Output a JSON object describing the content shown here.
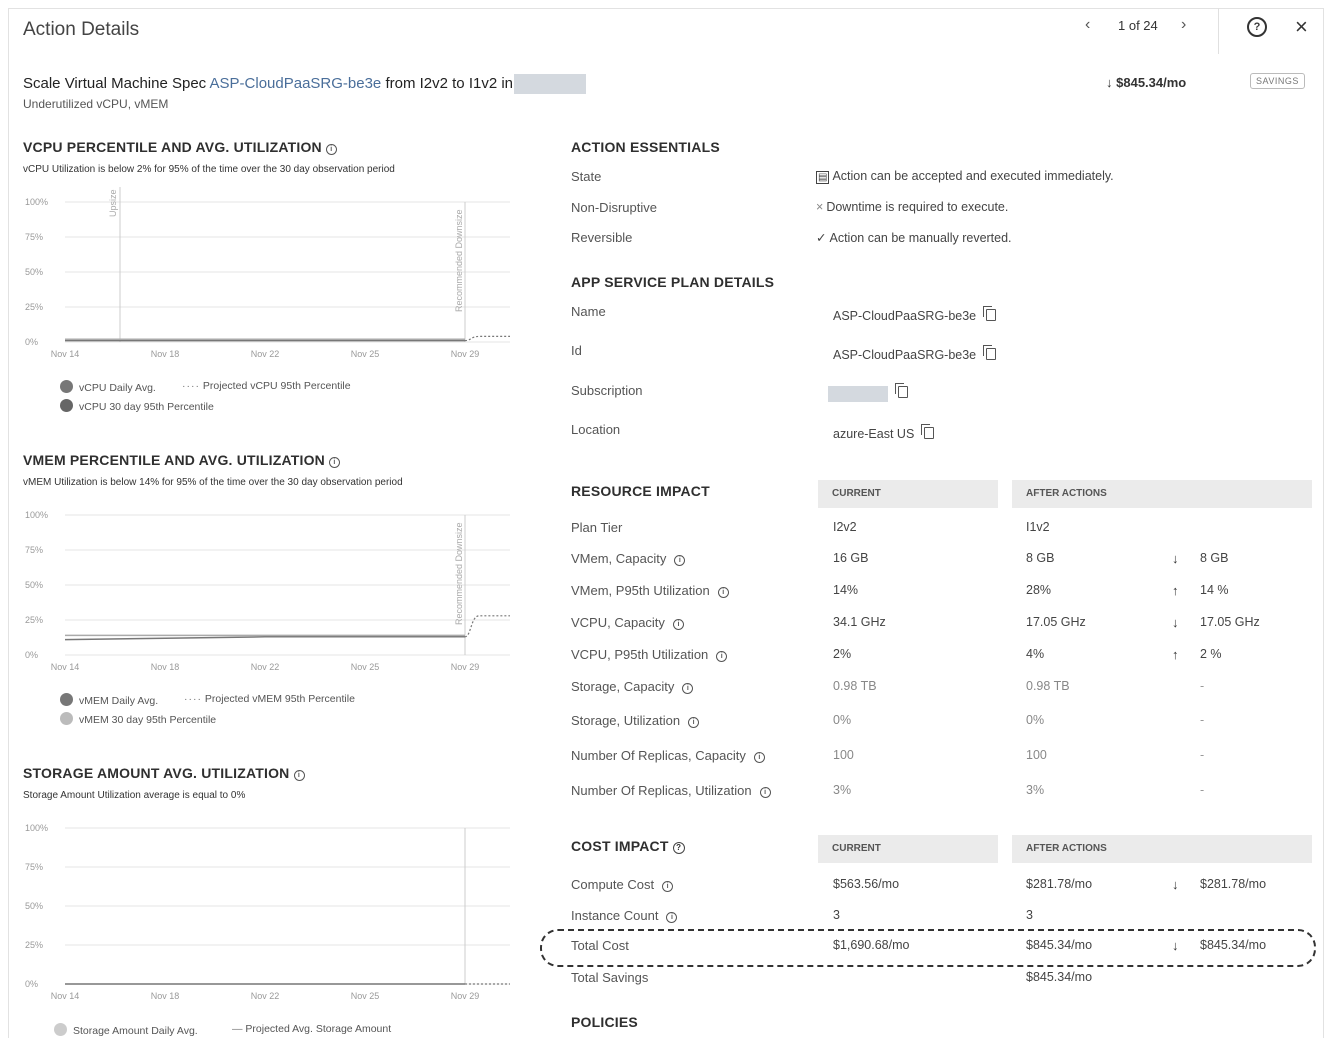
{
  "header": {
    "title": "Action Details",
    "prev_icon": "chevron-left-icon",
    "page_indicator": "1 of 24",
    "next_icon": "chevron-right-icon",
    "help_icon": "help-circle-icon",
    "close_icon": "close-icon"
  },
  "action": {
    "prefix": "Scale Virtual Machine Spec",
    "entity": "ASP-CloudPaaSRG-be3e",
    "suffix": "from I2v2 to I1v2 in",
    "subtitle": "Underutilized vCPU, vMEM",
    "savings_amount": "$845.34/mo",
    "badge": "SAVINGS"
  },
  "charts": {
    "x_ticks": [
      "Nov 14",
      "Nov 18",
      "Nov 22",
      "Nov 25",
      "Nov 29"
    ],
    "y_ticks": [
      "100%",
      "75%",
      "50%",
      "25%",
      "0%"
    ],
    "vcpu": {
      "title": "VCPU PERCENTILE AND AVG. UTILIZATION",
      "subtitle": "vCPU Utilization is below 2% for 95% of the time over the 30 day observation period",
      "markers": [
        "Upsize",
        "Recommended Downsize"
      ],
      "legend": [
        "vCPU Daily Avg.",
        "Projected vCPU 95th Percentile",
        "vCPU 30 day 95th Percentile"
      ]
    },
    "vmem": {
      "title": "VMEM PERCENTILE AND AVG. UTILIZATION",
      "subtitle": "vMEM Utilization is below 14% for 95% of the time over the 30 day observation period",
      "markers": [
        "Recommended Downsize"
      ],
      "legend": [
        "vMEM Daily Avg.",
        "Projected vMEM 95th Percentile",
        "vMEM 30 day 95th Percentile"
      ]
    },
    "storage": {
      "title": "STORAGE AMOUNT AVG. UTILIZATION",
      "subtitle": "Storage Amount Utilization average is equal to 0%",
      "legend": [
        "Storage Amount Daily Avg.",
        "Projected Avg. Storage Amount"
      ]
    }
  },
  "chart_data": [
    {
      "type": "line",
      "title": "VCPU PERCENTILE AND AVG. UTILIZATION",
      "x": [
        "Nov 14",
        "Nov 18",
        "Nov 22",
        "Nov 25",
        "Nov 29"
      ],
      "ylim": [
        0,
        100
      ],
      "series": [
        {
          "name": "vCPU Daily Avg.",
          "values": [
            1,
            1,
            1,
            1,
            1
          ]
        },
        {
          "name": "vCPU 30 day 95th Percentile",
          "values": [
            2,
            2,
            2,
            2,
            2
          ]
        },
        {
          "name": "Projected vCPU 95th Percentile",
          "values": [
            4
          ]
        }
      ]
    },
    {
      "type": "line",
      "title": "VMEM PERCENTILE AND AVG. UTILIZATION",
      "x": [
        "Nov 14",
        "Nov 18",
        "Nov 22",
        "Nov 25",
        "Nov 29"
      ],
      "ylim": [
        0,
        100
      ],
      "series": [
        {
          "name": "vMEM Daily Avg.",
          "values": [
            11,
            12,
            13,
            13,
            13
          ]
        },
        {
          "name": "vMEM 30 day 95th Percentile",
          "values": [
            14,
            14,
            14,
            14,
            14
          ]
        },
        {
          "name": "Projected vMEM 95th Percentile",
          "values": [
            28
          ]
        }
      ]
    },
    {
      "type": "line",
      "title": "STORAGE AMOUNT AVG. UTILIZATION",
      "x": [
        "Nov 14",
        "Nov 18",
        "Nov 22",
        "Nov 25",
        "Nov 29"
      ],
      "ylim": [
        0,
        100
      ],
      "series": [
        {
          "name": "Storage Amount Daily Avg.",
          "values": [
            0,
            0,
            0,
            0,
            0
          ]
        },
        {
          "name": "Projected Avg. Storage Amount",
          "values": [
            0
          ]
        }
      ]
    }
  ],
  "essentials": {
    "title": "ACTION ESSENTIALS",
    "rows": [
      {
        "label": "State",
        "icon": "calendar-icon",
        "value": "Action can be accepted and executed immediately."
      },
      {
        "label": "Non-Disruptive",
        "icon": "x-icon",
        "value": "Downtime is required to execute."
      },
      {
        "label": "Reversible",
        "icon": "check-icon",
        "value": "Action can be manually reverted."
      }
    ]
  },
  "plan": {
    "title": "APP SERVICE PLAN DETAILS",
    "rows": [
      {
        "label": "Name",
        "value": "ASP-CloudPaaSRG-be3e"
      },
      {
        "label": "Id",
        "value": "ASP-CloudPaaSRG-be3e"
      },
      {
        "label": "Subscription",
        "value": ""
      },
      {
        "label": "Location",
        "value": "azure-East US"
      }
    ]
  },
  "resource": {
    "title": "RESOURCE IMPACT",
    "col_current": "CURRENT",
    "col_after": "AFTER ACTIONS",
    "rows": [
      {
        "label": "Plan Tier",
        "current": "I2v2",
        "after": "I1v2",
        "arrow": "",
        "delta": ""
      },
      {
        "label": "VMem, Capacity",
        "current": "16 GB",
        "after": "8 GB",
        "arrow": "↓",
        "delta": "8 GB"
      },
      {
        "label": "VMem, P95th Utilization",
        "current": "14%",
        "after": "28%",
        "arrow": "↑",
        "delta": "14 %"
      },
      {
        "label": "VCPU, Capacity",
        "current": "34.1 GHz",
        "after": "17.05 GHz",
        "arrow": "↓",
        "delta": "17.05 GHz"
      },
      {
        "label": "VCPU, P95th Utilization",
        "current": "2%",
        "after": "4%",
        "arrow": "↑",
        "delta": "2 %"
      },
      {
        "label": "Storage, Capacity",
        "current": "0.98 TB",
        "after": "0.98 TB",
        "arrow": "",
        "delta": "-"
      },
      {
        "label": "Storage, Utilization",
        "current": "0%",
        "after": "0%",
        "arrow": "",
        "delta": "-"
      },
      {
        "label": "Number Of Replicas, Capacity",
        "current": "100",
        "after": "100",
        "arrow": "",
        "delta": "-"
      },
      {
        "label": "Number Of Replicas, Utilization",
        "current": "3%",
        "after": "3%",
        "arrow": "",
        "delta": "-"
      }
    ]
  },
  "cost": {
    "title": "COST IMPACT",
    "col_current": "CURRENT",
    "col_after": "AFTER ACTIONS",
    "rows": [
      {
        "label": "Compute Cost",
        "current": "$563.56/mo",
        "after": "$281.78/mo",
        "arrow": "↓",
        "delta": "$281.78/mo"
      },
      {
        "label": "Instance Count",
        "current": "3",
        "after": "3",
        "arrow": "",
        "delta": ""
      },
      {
        "label": "Total Cost",
        "current": "$1,690.68/mo",
        "after": "$845.34/mo",
        "arrow": "↓",
        "delta": "$845.34/mo"
      },
      {
        "label": "Total Savings",
        "current": "",
        "after": "$845.34/mo",
        "arrow": "",
        "delta": ""
      }
    ]
  },
  "policies": {
    "title": "POLICIES"
  }
}
